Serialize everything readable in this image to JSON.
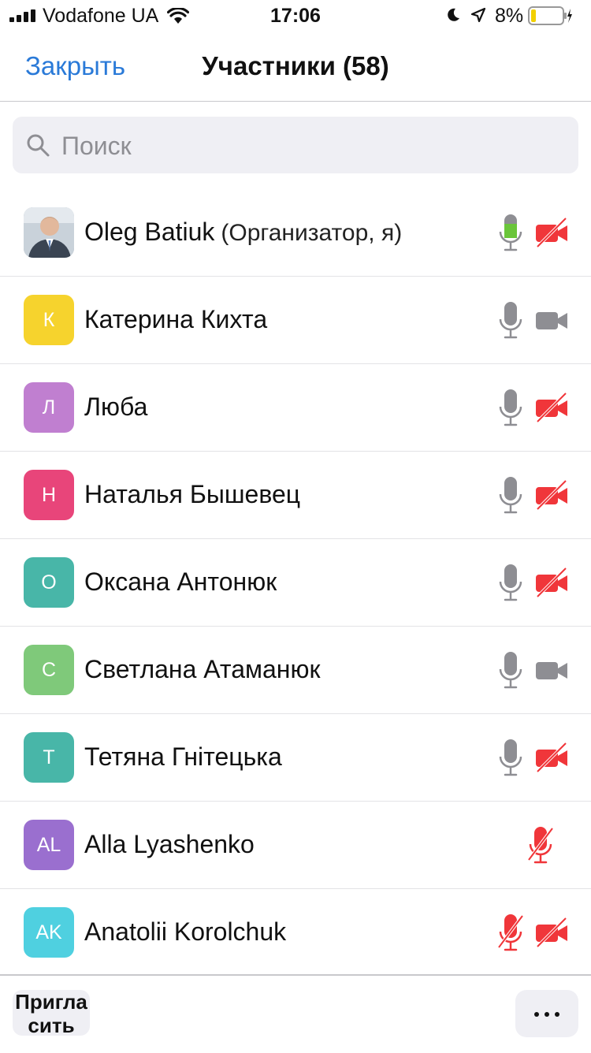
{
  "status_bar": {
    "carrier": "Vodafone UA",
    "time": "17:06",
    "battery_percent": "8%",
    "icons": [
      "signal-icon",
      "wifi-icon",
      "moon-icon",
      "location-icon",
      "battery-icon",
      "charging-icon"
    ]
  },
  "header": {
    "close_label": "Закрыть",
    "title": "Участники (58)"
  },
  "search": {
    "placeholder": "Поиск",
    "value": ""
  },
  "participants": [
    {
      "name": "Oleg Batiuk",
      "role": "(Организатор, я)",
      "initial": "",
      "avatar": "photo",
      "mic": "active",
      "video": "off"
    },
    {
      "name": "Катерина Кихта",
      "initial": "К",
      "avatar_color": "#f6d32d",
      "mic": "on",
      "video": "on"
    },
    {
      "name": "Люба",
      "initial": "Л",
      "avatar_color": "#c07fd0",
      "mic": "on",
      "video": "off"
    },
    {
      "name": "Наталья Бышевец",
      "initial": "Н",
      "avatar_color": "#e8457a",
      "mic": "on",
      "video": "off"
    },
    {
      "name": "Оксана Антонюк",
      "initial": "О",
      "avatar_color": "#48b6a8",
      "mic": "on",
      "video": "off"
    },
    {
      "name": "Светлана Атаманюк",
      "initial": "С",
      "avatar_color": "#7fc97a",
      "mic": "on",
      "video": "on"
    },
    {
      "name": "Тетяна Гнітецька",
      "initial": "Т",
      "avatar_color": "#48b6a8",
      "mic": "on",
      "video": "off"
    },
    {
      "name": "Alla Lyashenko",
      "initial": "AL",
      "avatar_color": "#9a6fcf",
      "mic": "muted",
      "video": "none"
    },
    {
      "name": "Anatolii Korolchuk",
      "initial": "AK",
      "avatar_color": "#4fd0e0",
      "mic": "muted",
      "video": "off"
    }
  ],
  "footer": {
    "invite_label": "Пригласить",
    "more_label": "more-icon"
  },
  "colors": {
    "accent": "#2a7ad8",
    "mic_active": "#6ac53a",
    "mic_gray": "#8e8e93",
    "off_red": "#f0363a"
  }
}
